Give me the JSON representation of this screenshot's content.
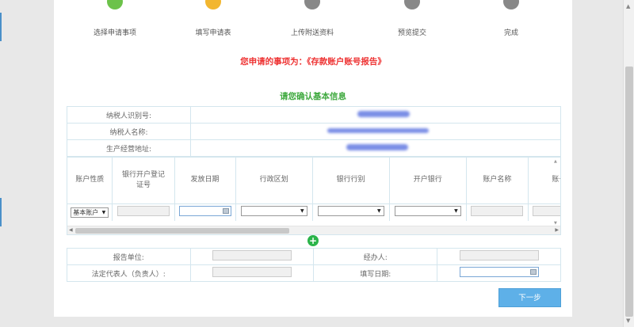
{
  "steps": [
    {
      "label": "选择申请事项",
      "color": "#6cc24a"
    },
    {
      "label": "填写申请表",
      "color": "#f2b630"
    },
    {
      "label": "上传附送资料",
      "color": "#888888"
    },
    {
      "label": "预览提交",
      "color": "#888888"
    },
    {
      "label": "完成",
      "color": "#888888"
    }
  ],
  "notice": "您申请的事项为：《存款账户账号报告》",
  "confirm_title": "请您确认基本信息",
  "info": {
    "taxpayer_id_label": "纳税人识别号:",
    "taxpayer_name_label": "纳税人名称:",
    "address_label": "生产经营地址:"
  },
  "grid": {
    "columns": [
      "账户性质",
      "银行开户登记证号",
      "发放日期",
      "行政区划",
      "银行行别",
      "开户银行",
      "账户名称",
      "账号"
    ],
    "row": {
      "account_type": "基本账户"
    }
  },
  "footer": {
    "reporting_unit_label": "报告单位:",
    "handler_label": "经办人:",
    "legal_rep_label": "法定代表人（负责人）:",
    "fill_date_label": "填写日期:"
  },
  "next_button": "下一步",
  "colors": {
    "accent": "#5eb0e8",
    "notice": "#ee3333",
    "title": "#3ea93e",
    "add": "#2bb44a"
  }
}
